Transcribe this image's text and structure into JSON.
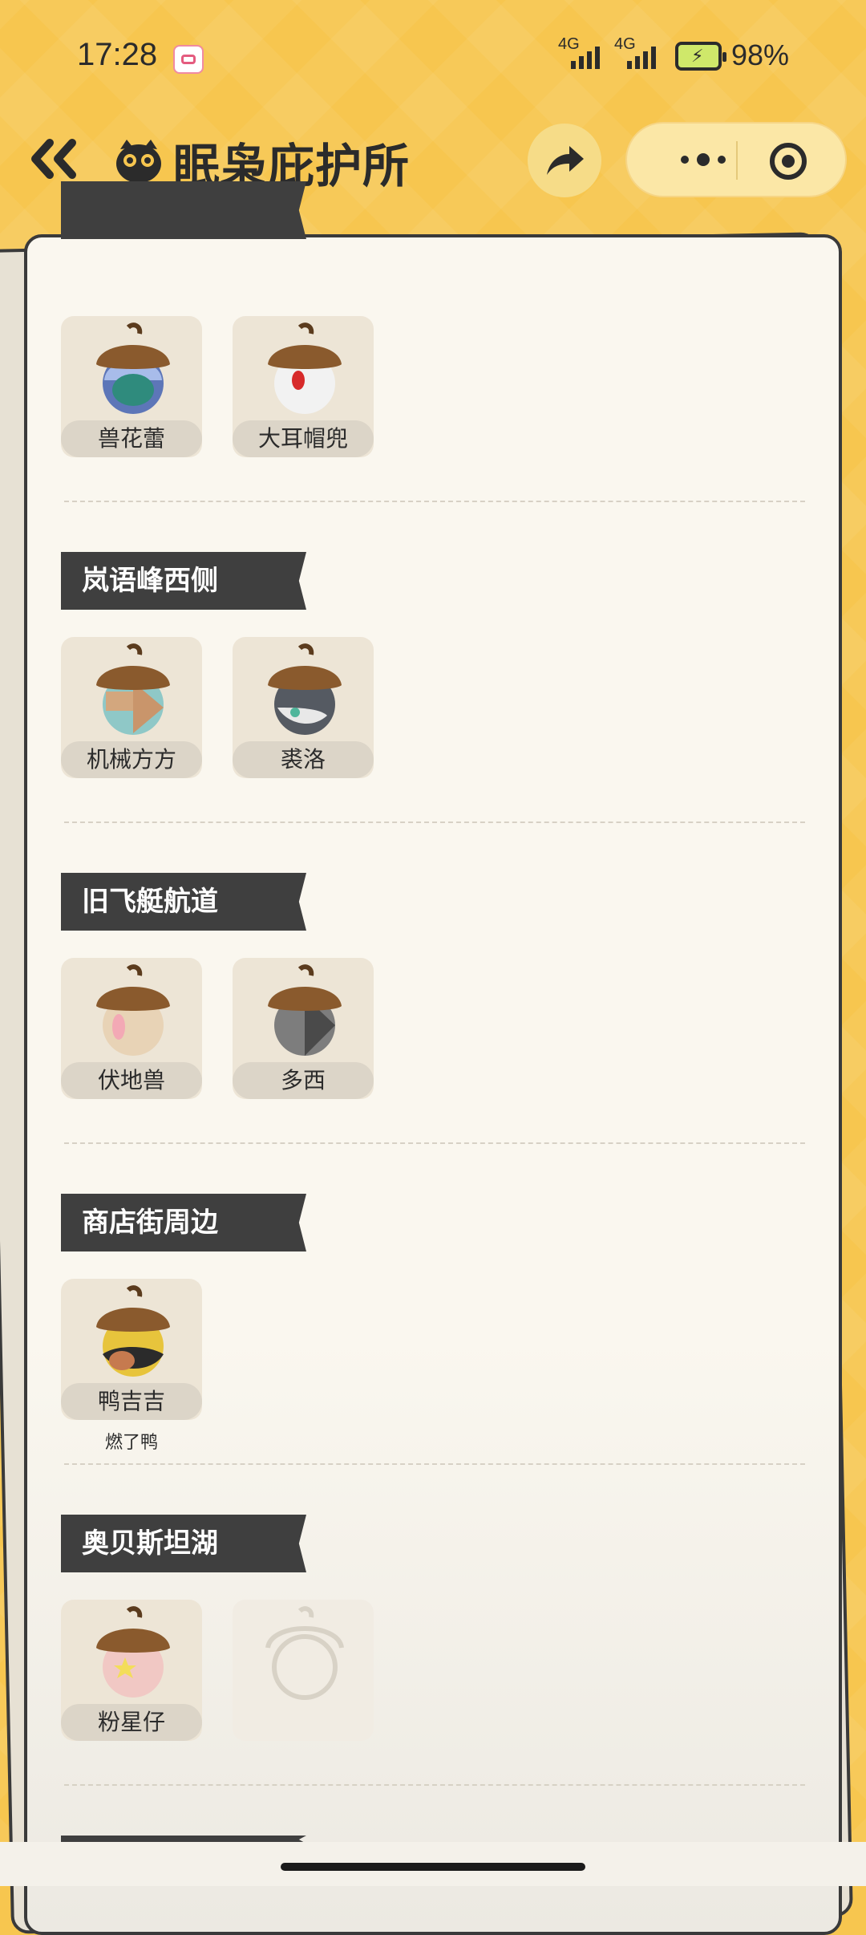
{
  "status_bar": {
    "time": "17:28",
    "network_1": "4G",
    "network_2": "4G",
    "battery_percent": "98%"
  },
  "header": {
    "title": "眠枭庇护所",
    "back_icon": "double-chevron-left-icon",
    "share_icon": "share-arrow-icon",
    "more_icon": "more-dots-icon",
    "close_icon": "target-circle-icon"
  },
  "sections": [
    {
      "title": "",
      "items": [
        {
          "name": "兽花蕾",
          "body_color": "#5d76b8"
        },
        {
          "name": "大耳帽兜",
          "body_color": "#f2f2f2"
        }
      ]
    },
    {
      "title": "岚语峰西侧",
      "items": [
        {
          "name": "机械方方",
          "body_color": "#8fc8c7"
        },
        {
          "name": "裘洛",
          "body_color": "#555a62"
        }
      ]
    },
    {
      "title": "旧飞艇航道",
      "items": [
        {
          "name": "伏地兽",
          "body_color": "#e8d3b6"
        },
        {
          "name": "多西",
          "body_color": "#7d7d7d"
        }
      ]
    },
    {
      "title": "商店街周边",
      "items": [
        {
          "name": "鸭吉吉",
          "body_color": "#e7c43c",
          "note": "燃了鸭"
        }
      ]
    },
    {
      "title": "奥贝斯坦湖",
      "items": [
        {
          "name": "粉星仔",
          "body_color": "#f1c8c4"
        },
        {
          "name": "",
          "empty": true
        }
      ]
    }
  ],
  "colors": {
    "background": "#f7c64f",
    "paper": "#faf7ef",
    "tag": "#3f3f3f"
  }
}
